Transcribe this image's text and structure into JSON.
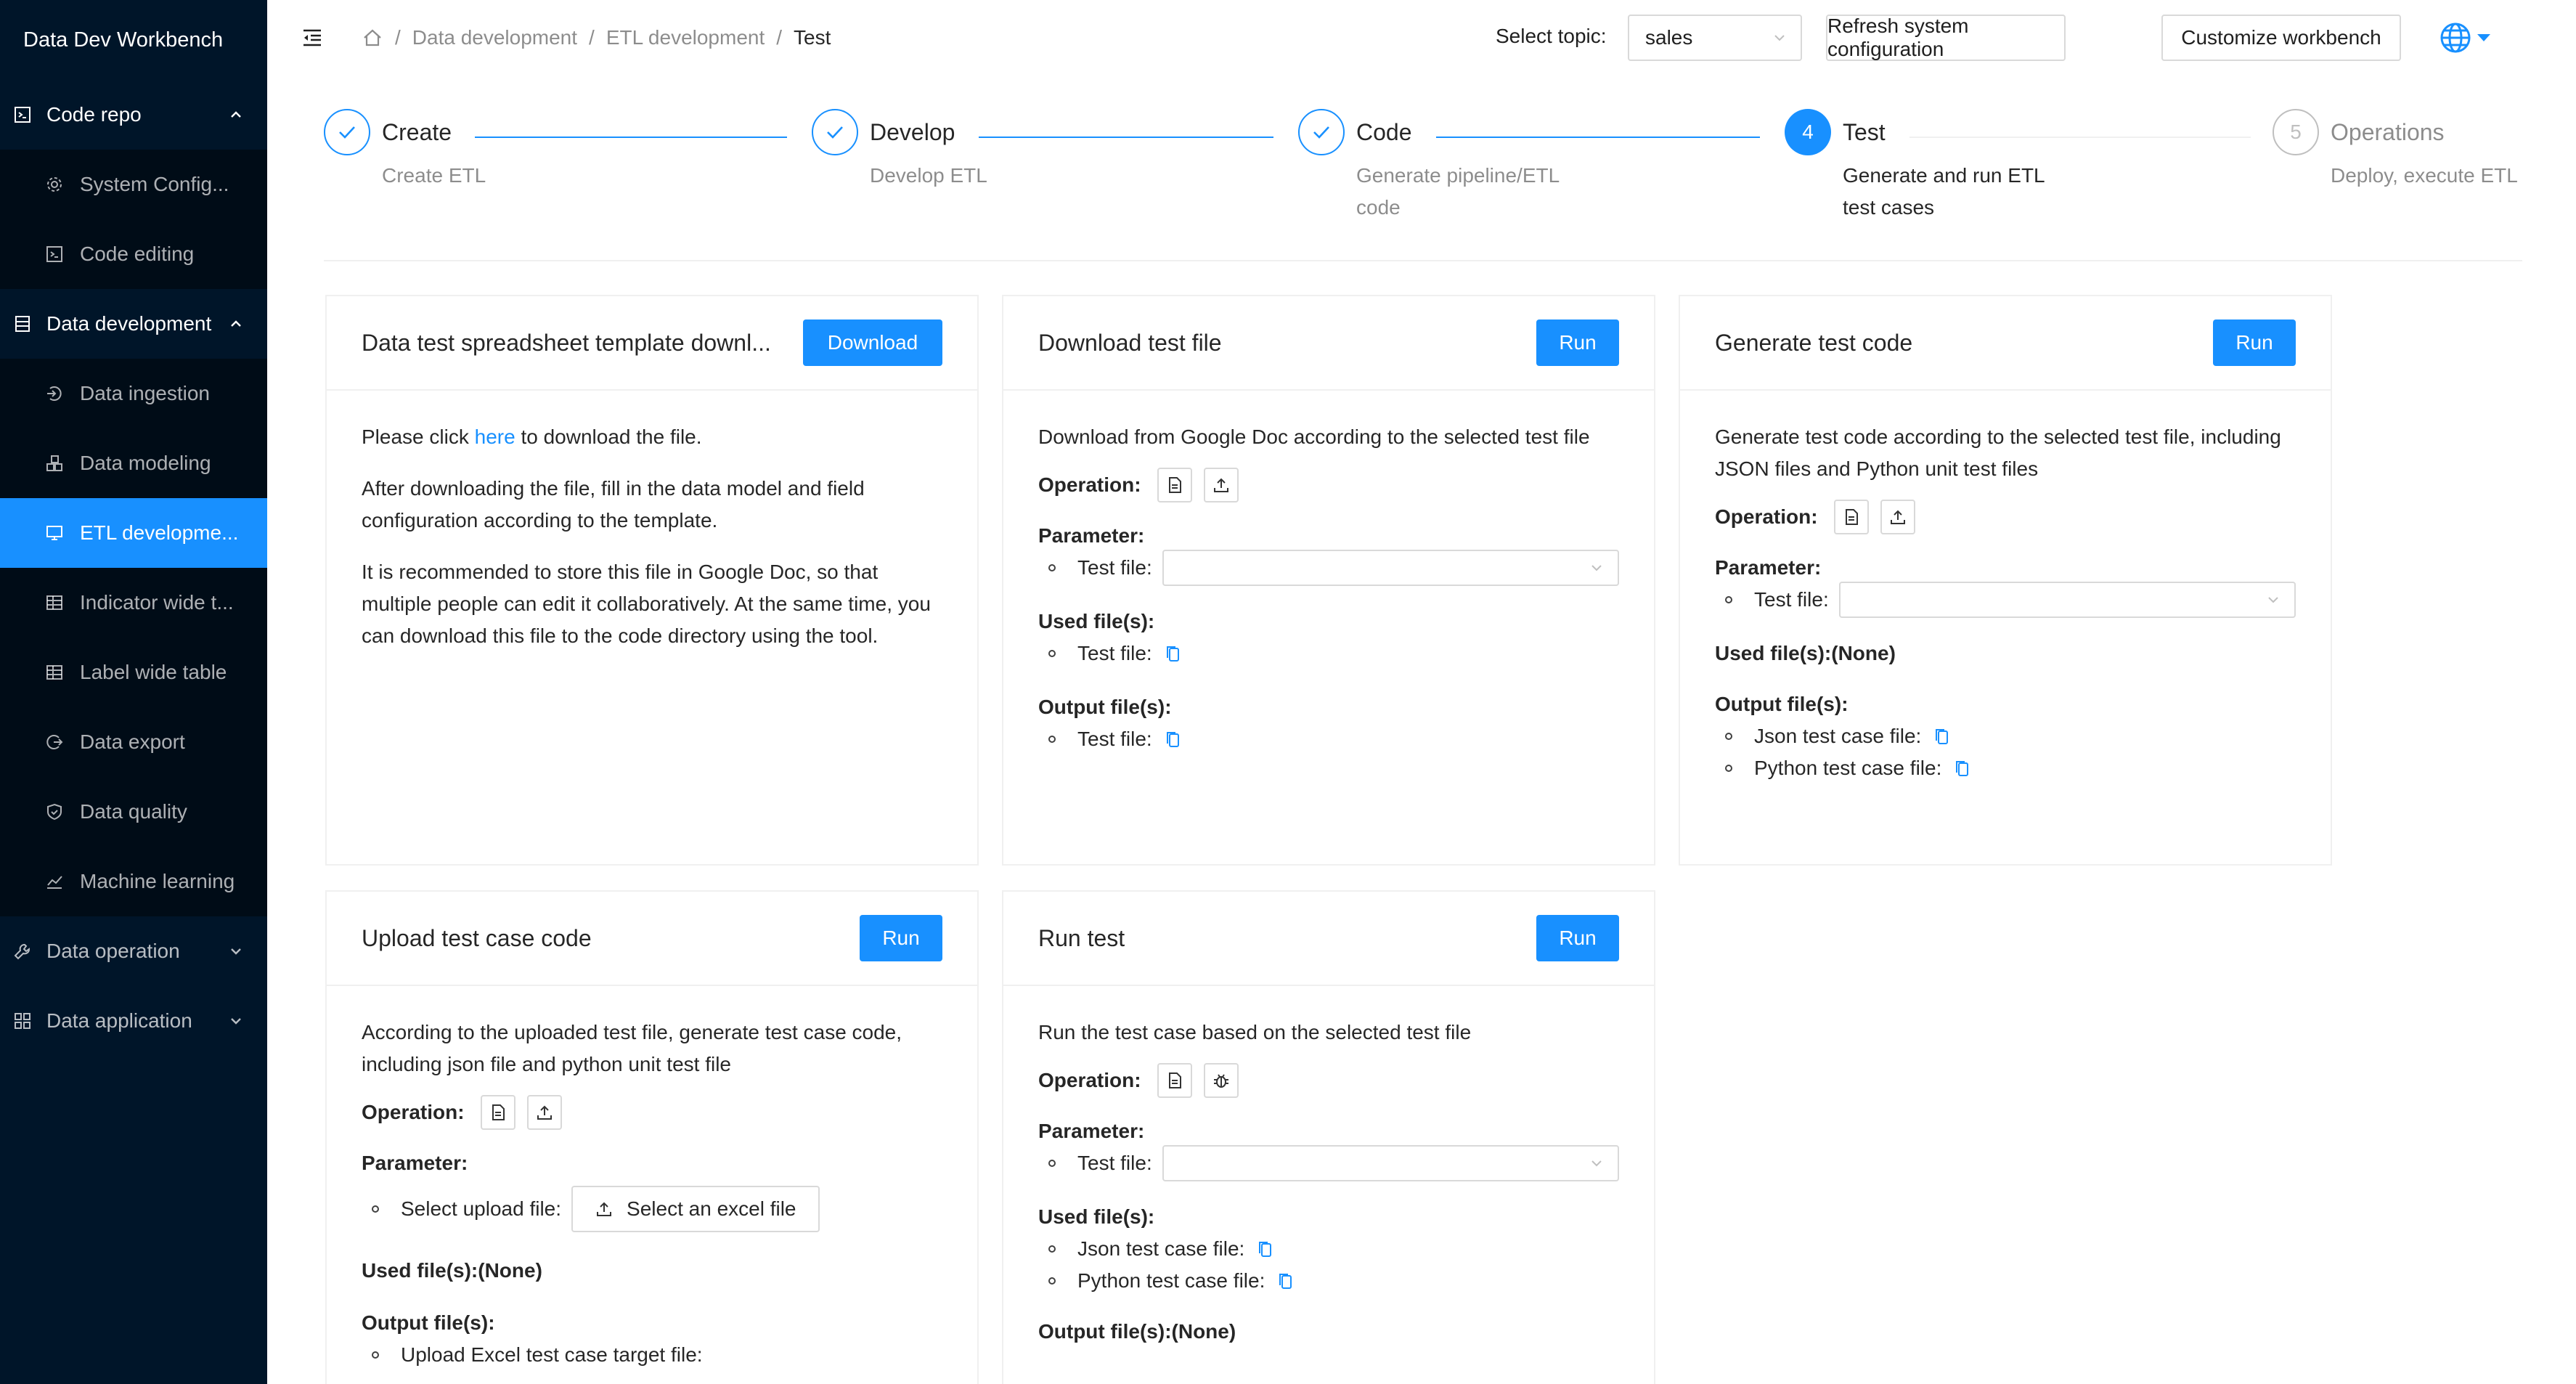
{
  "app": {
    "title": "Data Dev Workbench"
  },
  "sidebar": {
    "groups": [
      {
        "label": "Code repo",
        "items": [
          {
            "label": "System Config..."
          },
          {
            "label": "Code editing"
          }
        ]
      },
      {
        "label": "Data development",
        "items": [
          {
            "label": "Data ingestion"
          },
          {
            "label": "Data modeling"
          },
          {
            "label": "ETL developme..."
          },
          {
            "label": "Indicator wide t..."
          },
          {
            "label": "Label wide table"
          },
          {
            "label": "Data export"
          },
          {
            "label": "Data quality"
          },
          {
            "label": "Machine learning"
          }
        ]
      },
      {
        "label": "Data operation"
      },
      {
        "label": "Data application"
      }
    ]
  },
  "header": {
    "breadcrumb": [
      "Data development",
      "ETL development",
      "Test"
    ],
    "topic_label": "Select topic",
    "topic_value": "sales",
    "refresh_label": "Refresh system configuration",
    "customize_label": "Customize workbench"
  },
  "steps": [
    {
      "title": "Create",
      "desc": "Create ETL",
      "status": "done"
    },
    {
      "title": "Develop",
      "desc": "Develop ETL",
      "status": "done"
    },
    {
      "title": "Code",
      "desc": "Generate pipeline/ETL code",
      "status": "done"
    },
    {
      "title": "Test",
      "number": "4",
      "desc": "Generate and run ETL test cases",
      "status": "current"
    },
    {
      "title": "Operations",
      "number": "5",
      "desc": "Deploy, execute ETL",
      "status": "wait"
    }
  ],
  "cards": {
    "template": {
      "title": "Data test spreadsheet template downl...",
      "button": "Download",
      "p1_before": "Please click ",
      "p1_link": "here",
      "p1_after": " to download the file.",
      "p2": "After downloading the file, fill in the data model and field configuration according to the template.",
      "p3": "It is recommended to store this file in Google Doc, so that multiple people can edit it collaboratively. At the same time, you can download this file to the code directory using the tool."
    },
    "download": {
      "title": "Download test file",
      "button": "Run",
      "desc": "Download from Google Doc according to the selected test file",
      "operation": "Operation:",
      "parameter": "Parameter:",
      "param_label": "Test file",
      "used": "Used file(s):",
      "used_item": "Test file:",
      "output": "Output file(s):",
      "output_item": "Test file:"
    },
    "generate": {
      "title": "Generate test code",
      "button": "Run",
      "desc": "Generate test code according to the selected test file, including JSON files and Python unit test files",
      "operation": "Operation:",
      "parameter": "Parameter:",
      "param_label": "Test file",
      "used": "Used file(s):(None)",
      "output": "Output file(s):",
      "output_item1": "Json test case file:",
      "output_item2": "Python test case file:"
    },
    "upload": {
      "title": "Upload test case code",
      "button": "Run",
      "desc": "According to the uploaded test file, generate test case code, including json file and python unit test file",
      "operation": "Operation:",
      "parameter": "Parameter:",
      "param_label": "Select upload file",
      "upload_button": "Select an excel file",
      "used": "Used file(s):(None)",
      "output": "Output file(s):",
      "output_item": "Upload Excel test case target file:"
    },
    "run": {
      "title": "Run test",
      "button": "Run",
      "desc": "Run the test case based on the selected test file",
      "operation": "Operation:",
      "parameter": "Parameter:",
      "param_label": "Test file",
      "used": "Used file(s):",
      "used_item1": "Json test case file:",
      "used_item2": "Python test case file:",
      "output": "Output file(s):(None)"
    }
  },
  "colors": {
    "primary": "#1890ff",
    "sidebar_bg": "#001529",
    "submenu_bg": "#000c17"
  },
  "icons": [
    "menu-fold-icon",
    "home-icon",
    "chevron-down-icon",
    "globe-icon",
    "check-icon",
    "file-icon",
    "upload-icon",
    "bug-icon",
    "copy-icon"
  ]
}
